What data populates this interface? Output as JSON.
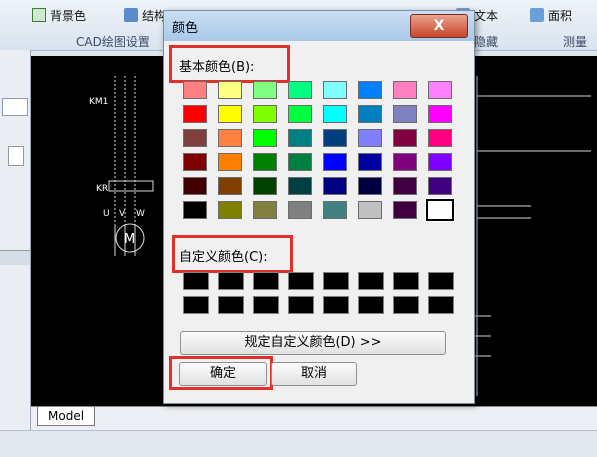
{
  "ribbon": {
    "bg_color_btn": "背景色",
    "struct_btn": "结构",
    "group_label": "CAD绘图设置",
    "text_btn": "文本",
    "area_btn": "面积",
    "hide_group": "隐藏",
    "measure_group": "测量"
  },
  "canvas": {
    "labels": {
      "km1": "KM1",
      "kr": "KR",
      "u": "U",
      "v": "V",
      "w": "W",
      "motor": "M"
    }
  },
  "model_tab": "Model",
  "dialog": {
    "title": "颜色",
    "close": "X",
    "basic_label": "基本颜色(B):",
    "custom_label": "自定义颜色(C):",
    "define_button": "规定自定义颜色(D) >>",
    "ok_button": "确定",
    "cancel_button": "取消",
    "basic_colors": [
      [
        "#ff8080",
        "#ffff80",
        "#80ff80",
        "#00ff80",
        "#80ffff",
        "#0080ff",
        "#ff80c0",
        "#ff80ff"
      ],
      [
        "#ff0000",
        "#ffff00",
        "#80ff00",
        "#00ff40",
        "#00ffff",
        "#0080c0",
        "#8080c0",
        "#ff00ff"
      ],
      [
        "#804040",
        "#ff8040",
        "#00ff00",
        "#008080",
        "#004080",
        "#8080ff",
        "#800040",
        "#ff0080"
      ],
      [
        "#800000",
        "#ff8000",
        "#008000",
        "#008040",
        "#0000ff",
        "#0000a0",
        "#800080",
        "#8000ff"
      ],
      [
        "#400000",
        "#804000",
        "#004000",
        "#004040",
        "#000080",
        "#000040",
        "#400040",
        "#400080"
      ],
      [
        "#000000",
        "#808000",
        "#808040",
        "#808080",
        "#408080",
        "#c0c0c0",
        "#400040",
        "#ffffff"
      ]
    ],
    "selected_swatch": "row6-col8",
    "custom_colors": [
      "#000000",
      "#000000",
      "#000000",
      "#000000",
      "#000000",
      "#000000",
      "#000000",
      "#000000",
      "#000000",
      "#000000",
      "#000000",
      "#000000",
      "#000000",
      "#000000",
      "#000000",
      "#000000"
    ]
  },
  "highlight_color": "#e0302a"
}
